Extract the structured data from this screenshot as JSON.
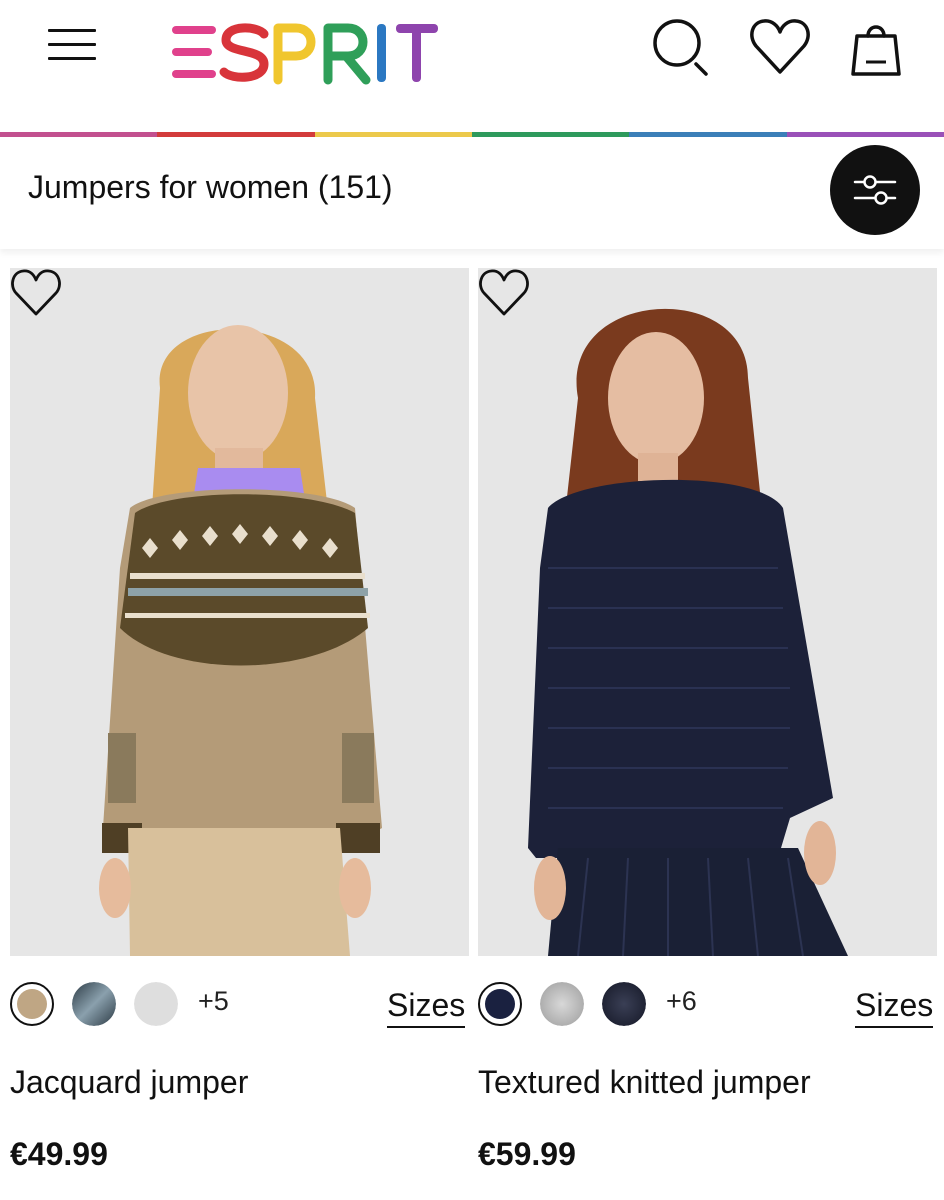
{
  "header": {
    "logo_text": "ESPRIT",
    "menu_icon": "hamburger-menu-icon",
    "search_icon": "search-icon",
    "wishlist_icon": "heart-icon",
    "bag_icon": "shopping-bag-icon"
  },
  "colors": {
    "rainbow": [
      "#c2508f",
      "#d33b3b",
      "#ecc94b",
      "#2e9a5c",
      "#3b7fb8",
      "#9a51b8"
    ],
    "logo": [
      "#e0418c",
      "#d8343a",
      "#f0c62e",
      "#2f9f59",
      "#2b78c2",
      "#8e44ad"
    ],
    "filter_button": "#111111"
  },
  "category": {
    "title": "Jumpers for women (151)",
    "filter_icon": "filter-sliders-icon"
  },
  "products": [
    {
      "name": "Jacquard jumper",
      "price": "€49.99",
      "more_colors": "+5",
      "sizes_label": "Sizes",
      "swatch_colors": [
        "#bfa684",
        "#3d4f5a",
        "#dedede"
      ],
      "photo_description_colors": {
        "background": "#e6e6e6",
        "sweater": "#b29a77",
        "pattern": "#5b4a2a"
      }
    },
    {
      "name": "Textured knitted jumper",
      "price": "€59.99",
      "more_colors": "+6",
      "sizes_label": "Sizes",
      "swatch_colors": [
        "#1a2140",
        "#b9b9b9",
        "#1f2233"
      ],
      "photo_description_colors": {
        "background": "#e6e6e6",
        "sweater": "#1c2139",
        "skirt": "#1a2035"
      }
    }
  ]
}
